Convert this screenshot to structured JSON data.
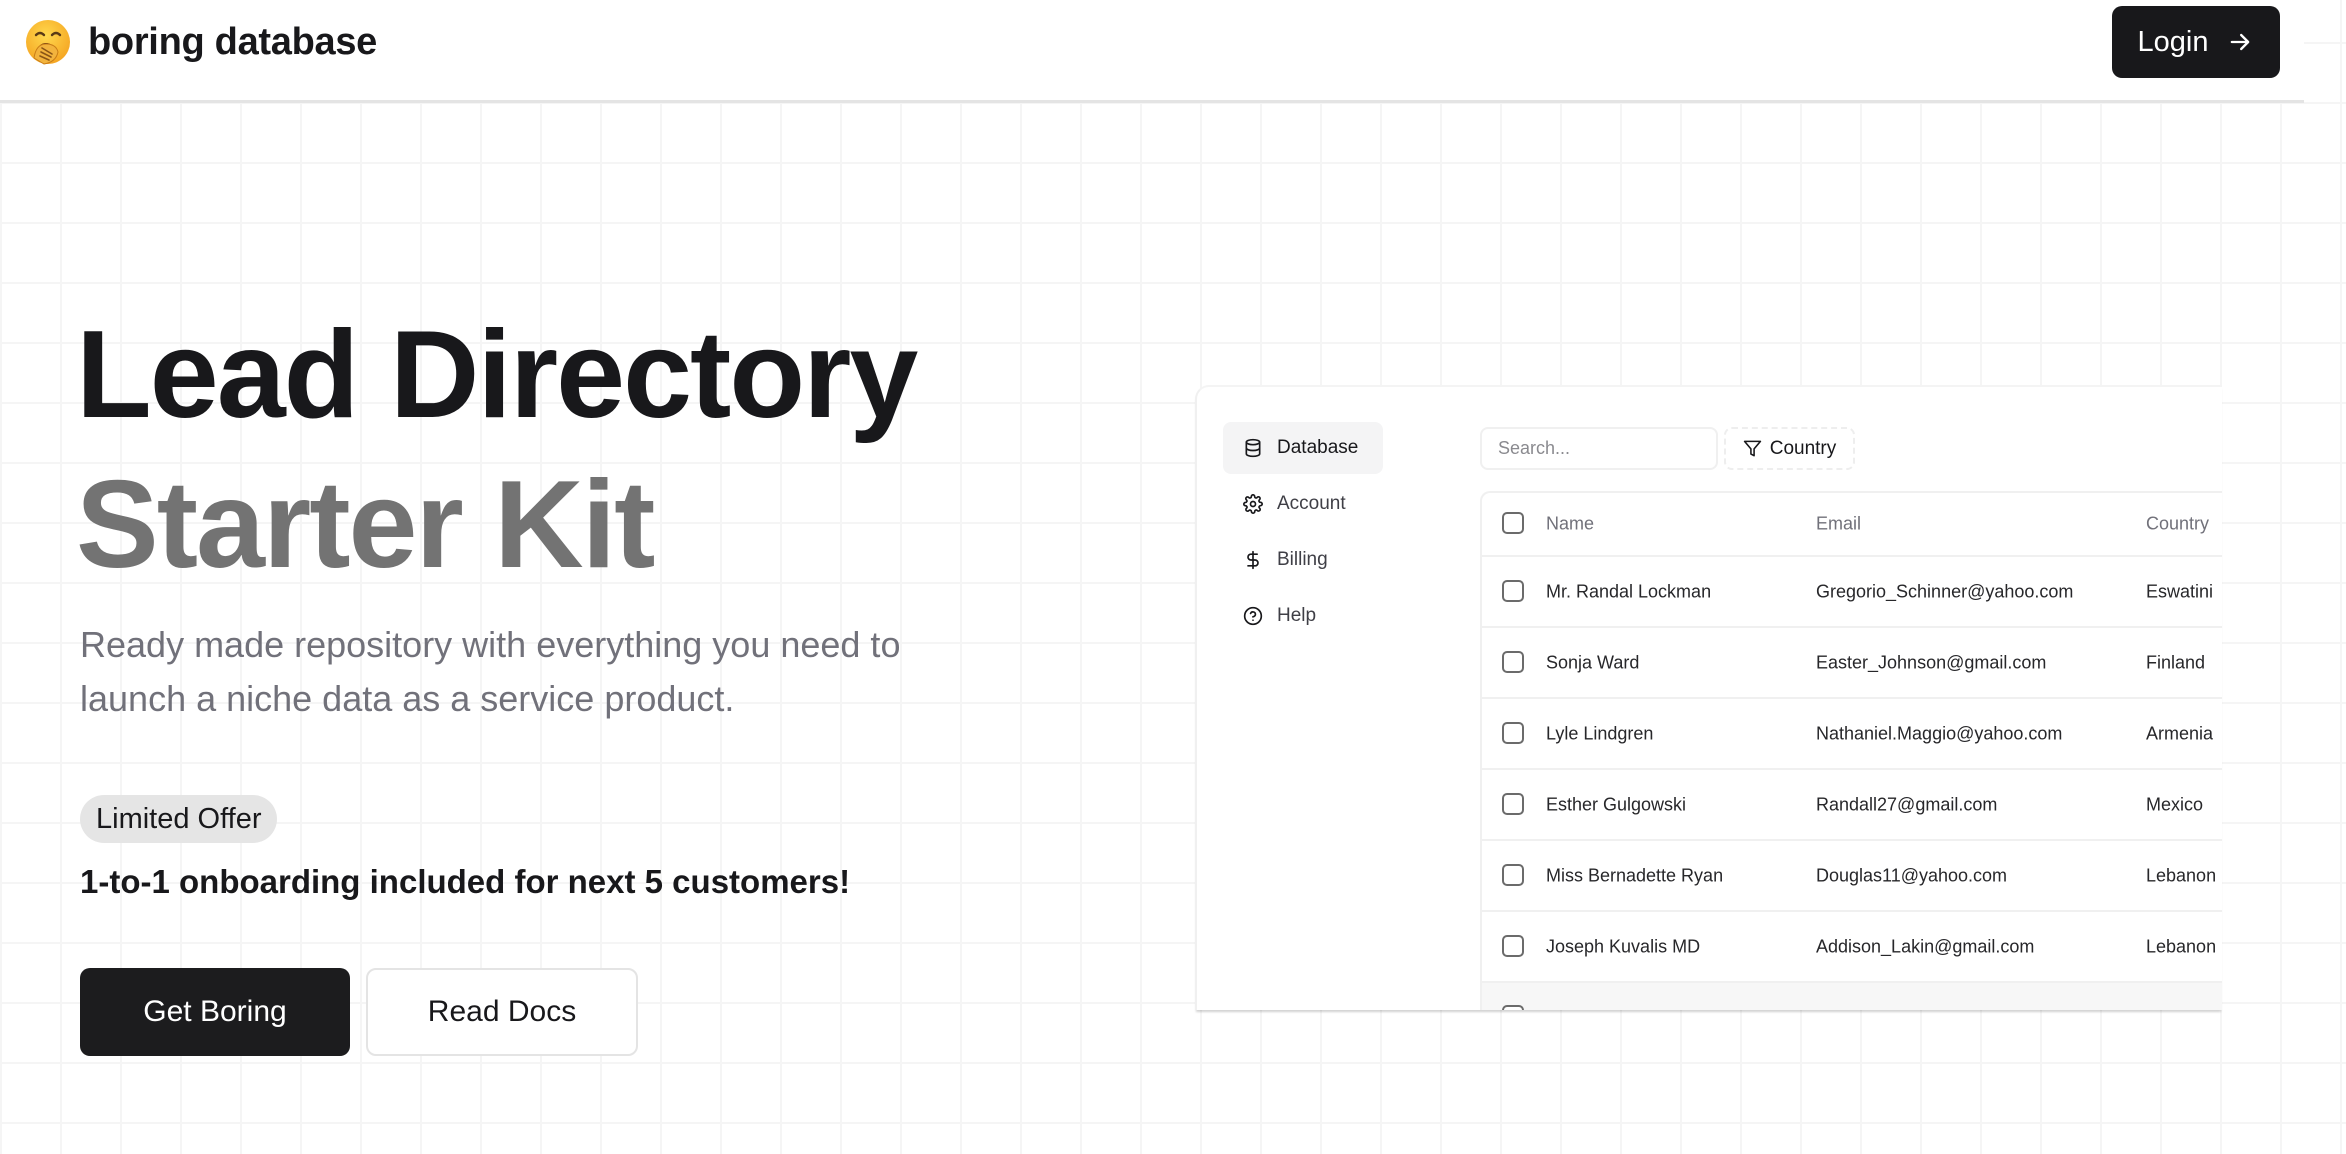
{
  "header": {
    "logo_icon": "yawning-face-emoji",
    "brand": "boring database",
    "login_label": "Login",
    "login_icon": "arrow-right-icon"
  },
  "hero": {
    "title_line1": "Lead Directory",
    "title_line2": "Starter Kit",
    "subtitle": "Ready made repository with everything you need to launch a niche data as a service product.",
    "badge": "Limited Offer",
    "offer": "1-to-1 onboarding included for next 5 customers!",
    "primary_button": "Get Boring",
    "secondary_button": "Read Docs"
  },
  "preview": {
    "sidebar": {
      "items": [
        {
          "label": "Database",
          "icon": "database-icon",
          "active": true
        },
        {
          "label": "Account",
          "icon": "gear-icon",
          "active": false
        },
        {
          "label": "Billing",
          "icon": "dollar-icon",
          "active": false
        },
        {
          "label": "Help",
          "icon": "help-circle-icon",
          "active": false
        }
      ]
    },
    "search": {
      "placeholder": "Search...",
      "value": ""
    },
    "filter": {
      "label": "Country",
      "icon": "filter-icon"
    },
    "table": {
      "columns": [
        "Name",
        "Email",
        "Country"
      ],
      "rows": [
        {
          "name": "Mr. Randal Lockman",
          "email": "Gregorio_Schinner@yahoo.com",
          "country": "Eswatini"
        },
        {
          "name": "Sonja Ward",
          "email": "Easter_Johnson@gmail.com",
          "country": "Finland"
        },
        {
          "name": "Lyle Lindgren",
          "email": "Nathaniel.Maggio@yahoo.com",
          "country": "Armenia"
        },
        {
          "name": "Esther Gulgowski",
          "email": "Randall27@gmail.com",
          "country": "Mexico"
        },
        {
          "name": "Miss Bernadette Ryan",
          "email": "Douglas11@yahoo.com",
          "country": "Lebanon"
        },
        {
          "name": "Joseph Kuvalis MD",
          "email": "Addison_Lakin@gmail.com",
          "country": "Lebanon"
        }
      ]
    }
  },
  "colors": {
    "primary": "#1c1c1e",
    "muted_text": "#71717a",
    "title_secondary": "#737373",
    "badge_bg": "#e5e5e5"
  }
}
